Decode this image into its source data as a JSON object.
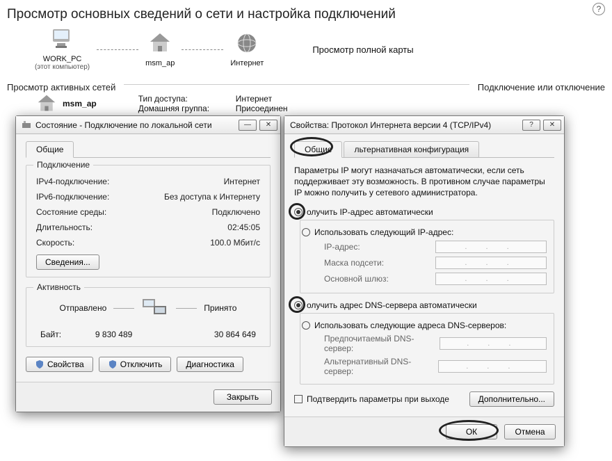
{
  "page": {
    "title": "Просмотр основных сведений о сети и настройка подключений",
    "full_map_link": "Просмотр полной карты",
    "active_networks_label": "Просмотр активных сетей",
    "conn_disc_label": "Подключение или отключение"
  },
  "map": {
    "node1": {
      "name": "WORK_PC",
      "sub": "(этот компьютер)"
    },
    "node2": {
      "name": "msm_ap"
    },
    "node3": {
      "name": "Интернет"
    }
  },
  "active": {
    "name": "msm_ap",
    "access_type_label": "Тип доступа:",
    "access_type_value": "Интернет",
    "homegroup_label": "Домашняя группа:",
    "homegroup_value": "Присоединен"
  },
  "status_win": {
    "title": "Состояние - Подключение по локальной сети",
    "tab_general": "Общие",
    "group_conn": "Подключение",
    "ipv4_label": "IPv4-подключение:",
    "ipv4_value": "Интернет",
    "ipv6_label": "IPv6-подключение:",
    "ipv6_value": "Без доступа к Интернету",
    "media_label": "Состояние среды:",
    "media_value": "Подключено",
    "duration_label": "Длительность:",
    "duration_value": "02:45:05",
    "speed_label": "Скорость:",
    "speed_value": "100.0 Мбит/с",
    "details_btn": "Сведения...",
    "group_activity": "Активность",
    "sent_label": "Отправлено",
    "recv_label": "Принято",
    "bytes_label": "Байт:",
    "sent_bytes": "9 830 489",
    "recv_bytes": "30 864 649",
    "props_btn": "Свойства",
    "disable_btn": "Отключить",
    "diag_btn": "Диагностика",
    "close_btn": "Закрыть"
  },
  "ipv4_win": {
    "title": "Свойства: Протокол Интернета версии 4 (TCP/IPv4)",
    "tab_general": "Общие",
    "tab_alt": "льтернативная конфигурация",
    "intro": "Параметры IP могут назначаться автоматически, если сеть поддерживает эту возможность. В противном случае параметры IP можно получить у сетевого администратора.",
    "obtain_ip": "олучить IP-адрес автоматически",
    "use_ip": "Использовать следующий IP-адрес:",
    "ip_label": "IP-адрес:",
    "mask_label": "Маска подсети:",
    "gw_label": "Основной шлюз:",
    "obtain_dns": "олучить адрес DNS-сервера автоматически",
    "use_dns": "Использовать следующие адреса DNS-серверов:",
    "dns1_label": "Предпочитаемый DNS-сервер:",
    "dns2_label": "Альтернативный DNS-сервер:",
    "validate_cb": "Подтвердить параметры при выходе",
    "advanced_btn": "Дополнительно...",
    "ok_btn": "ОК",
    "cancel_btn": "Отмена",
    "ip_placeholder": ". . ."
  }
}
